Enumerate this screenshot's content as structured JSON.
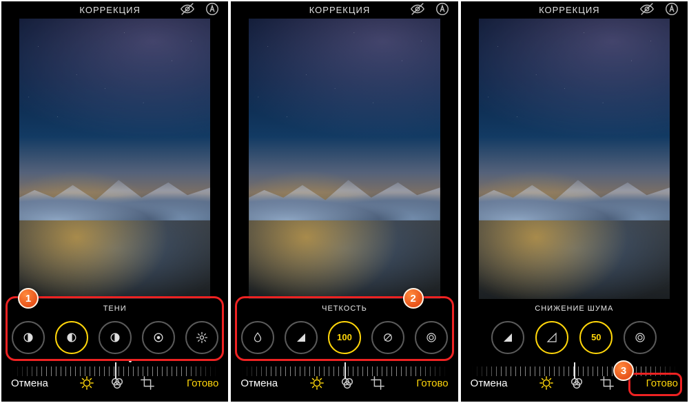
{
  "screens": [
    {
      "header": "КОРРЕКЦИЯ",
      "adj_label": "ТЕНИ",
      "dial_value": "",
      "cancel": "Отмена",
      "done": "Готово",
      "badge": "1",
      "center_pct": 50,
      "dot_pct": 57
    },
    {
      "header": "КОРРЕКЦИЯ",
      "adj_label": "ЧЕТКОСТЬ",
      "dial_value": "100",
      "cancel": "Отмена",
      "done": "Готово",
      "badge": "2",
      "center_pct": 50,
      "dot_pct": 50
    },
    {
      "header": "КОРРЕКЦИЯ",
      "adj_label": "СНИЖЕНИЕ ШУМА",
      "dial_value": "50",
      "cancel": "Отмена",
      "done": "Готово",
      "badge": "3",
      "center_pct": 50,
      "dot_pct": 50
    }
  ]
}
